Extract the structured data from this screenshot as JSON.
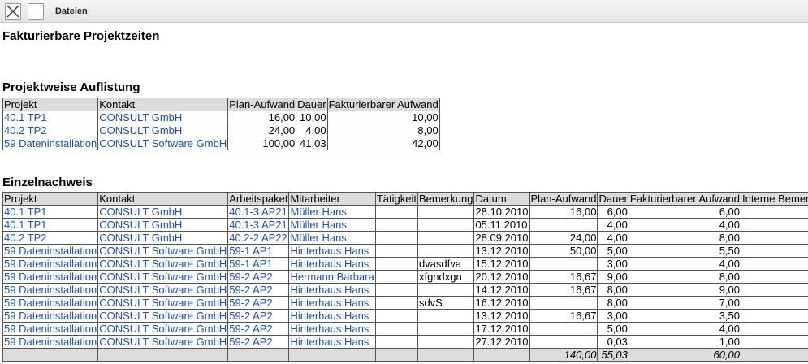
{
  "toolbar": {
    "tab_label": "Dateien"
  },
  "page": {
    "title": "Fakturierbare Projektzeiten"
  },
  "section1": {
    "title": "Projektweise Auflistung",
    "columns": [
      "Projekt",
      "Kontakt",
      "Plan-Aufwand",
      "Dauer",
      "Fakturierbarer Aufwand"
    ],
    "rows": [
      [
        "40.1 TP1",
        "CONSULT GmbH",
        "16,00",
        "10,00",
        "10,00"
      ],
      [
        "40.2 TP2",
        "CONSULT GmbH",
        "24,00",
        "4,00",
        "8,00"
      ],
      [
        "59 Dateninstallation",
        "CONSULT Software GmbH",
        "100,00",
        "41,03",
        "42,00"
      ]
    ]
  },
  "section2": {
    "title": "Einzelnachweis",
    "columns": [
      "Projekt",
      "Kontakt",
      "Arbeitspaket",
      "Mitarbeiter",
      "Tätigkeit",
      "Bemerkung",
      "Datum",
      "Plan-Aufwand",
      "Dauer",
      "Fakturierbarer Aufwand",
      "Interne Bemerkung"
    ],
    "rows": [
      [
        "40.1 TP1",
        "CONSULT GmbH",
        "40.1-3 AP21",
        "Müller Hans",
        "",
        "",
        "28.10.2010",
        "16,00",
        "6,00",
        "6,00",
        ""
      ],
      [
        "40.1 TP1",
        "CONSULT GmbH",
        "40.1-3 AP21",
        "Müller Hans",
        "",
        "",
        "05.11.2010",
        "",
        "4,00",
        "4,00",
        ""
      ],
      [
        "40.2 TP2",
        "CONSULT GmbH",
        "40.2-2 AP22",
        "Müller Hans",
        "",
        "",
        "28.09.2010",
        "24,00",
        "4,00",
        "8,00",
        ""
      ],
      [
        "59 Dateninstallation",
        "CONSULT Software GmbH",
        "59-1 AP1",
        "Hinterhaus Hans",
        "",
        "",
        "13.12.2010",
        "50,00",
        "5,00",
        "5,50",
        ""
      ],
      [
        "59 Dateninstallation",
        "CONSULT Software GmbH",
        "59-1 AP1",
        "Hinterhaus Hans",
        "",
        "dvasdfva",
        "15.12.2010",
        "",
        "3,00",
        "4,00",
        ""
      ],
      [
        "59 Dateninstallation",
        "CONSULT Software GmbH",
        "59-2 AP2",
        "Hermann Barbara",
        "",
        "xfgndxgn",
        "20.12.2010",
        "16,67",
        "9,00",
        "8,00",
        ""
      ],
      [
        "59 Dateninstallation",
        "CONSULT Software GmbH",
        "59-2 AP2",
        "Hinterhaus Hans",
        "",
        "",
        "14.12.2010",
        "16,67",
        "8,00",
        "9,00",
        ""
      ],
      [
        "59 Dateninstallation",
        "CONSULT Software GmbH",
        "59-2 AP2",
        "Hinterhaus Hans",
        "",
        "sdvS",
        "16.12.2010",
        "",
        "8,00",
        "7,00",
        ""
      ],
      [
        "59 Dateninstallation",
        "CONSULT Software GmbH",
        "59-2 AP2",
        "Hinterhaus Hans",
        "",
        "",
        "13.12.2010",
        "16,67",
        "3,00",
        "3,50",
        ""
      ],
      [
        "59 Dateninstallation",
        "CONSULT Software GmbH",
        "59-2 AP2",
        "Hinterhaus Hans",
        "",
        "",
        "17.12.2010",
        "",
        "5,00",
        "4,00",
        ""
      ],
      [
        "59 Dateninstallation",
        "CONSULT Software GmbH",
        "59-2 AP2",
        "Hinterhaus Hans",
        "",
        "",
        "27.12.2010",
        "",
        "0,03",
        "1,00",
        ""
      ]
    ],
    "totals": {
      "plan": "140,00",
      "dauer": "55,03",
      "fakt": "60,00"
    }
  },
  "colors": {
    "link": "#1c4fc4",
    "header_bg": "#dcdcdc"
  }
}
